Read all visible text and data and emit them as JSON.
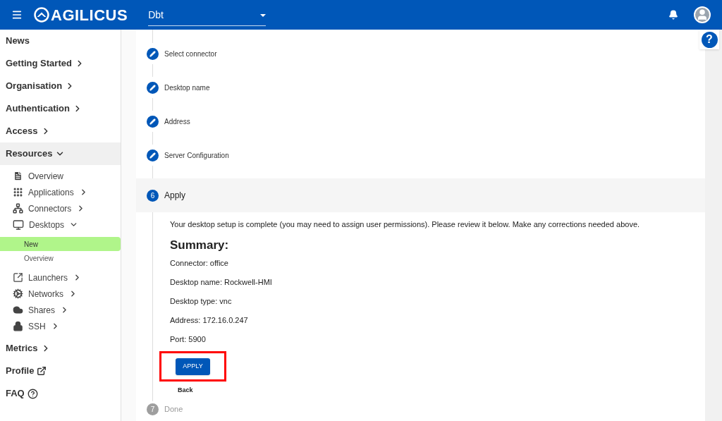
{
  "header": {
    "brand": "AGILICUS",
    "org_select": {
      "value": "Dbt"
    }
  },
  "help_button": "?",
  "sidebar": {
    "items": [
      {
        "label": "News",
        "kind": "link"
      },
      {
        "label": "Getting Started",
        "kind": "group",
        "expanded": false
      },
      {
        "label": "Organisation",
        "kind": "group",
        "expanded": false
      },
      {
        "label": "Authentication",
        "kind": "group",
        "expanded": false
      },
      {
        "label": "Access",
        "kind": "group",
        "expanded": false
      },
      {
        "label": "Resources",
        "kind": "group",
        "expanded": true,
        "children": [
          {
            "label": "Overview",
            "kind": "link"
          },
          {
            "label": "Applications",
            "kind": "group",
            "expanded": false
          },
          {
            "label": "Connectors",
            "kind": "group",
            "expanded": false
          },
          {
            "label": "Desktops",
            "kind": "group",
            "expanded": true,
            "children": [
              {
                "label": "New",
                "selected": true
              },
              {
                "label": "Overview",
                "selected": false
              }
            ]
          },
          {
            "label": "Launchers",
            "kind": "group",
            "expanded": false
          },
          {
            "label": "Networks",
            "kind": "group",
            "expanded": false
          },
          {
            "label": "Shares",
            "kind": "group",
            "expanded": false
          },
          {
            "label": "SSH",
            "kind": "group",
            "expanded": false
          }
        ]
      },
      {
        "label": "Metrics",
        "kind": "group",
        "expanded": false
      },
      {
        "label": "Profile",
        "kind": "external"
      },
      {
        "label": "FAQ",
        "kind": "help"
      }
    ]
  },
  "stepper": {
    "steps": [
      {
        "label": "Select connector",
        "kind": "completed"
      },
      {
        "label": "Desktop name",
        "kind": "completed"
      },
      {
        "label": "Address",
        "kind": "completed"
      },
      {
        "label": "Server Configuration",
        "kind": "completed"
      },
      {
        "label": "Apply",
        "kind": "active",
        "number": "6"
      },
      {
        "label": "Done",
        "kind": "pending",
        "number": "7"
      }
    ],
    "apply_content": {
      "message": "Your desktop setup is complete (you may need to assign user permissions). Please review it below. Make any corrections needed above.",
      "summary_title": "Summary:",
      "summary_lines": [
        "Connector: office",
        "Desktop name: Rockwell-HMI",
        "Desktop type: vnc",
        "Address: 172.16.0.247",
        "Port: 5900"
      ],
      "apply_button": "APPLY",
      "apply_highlighted": true,
      "back_button": "Back"
    }
  }
}
